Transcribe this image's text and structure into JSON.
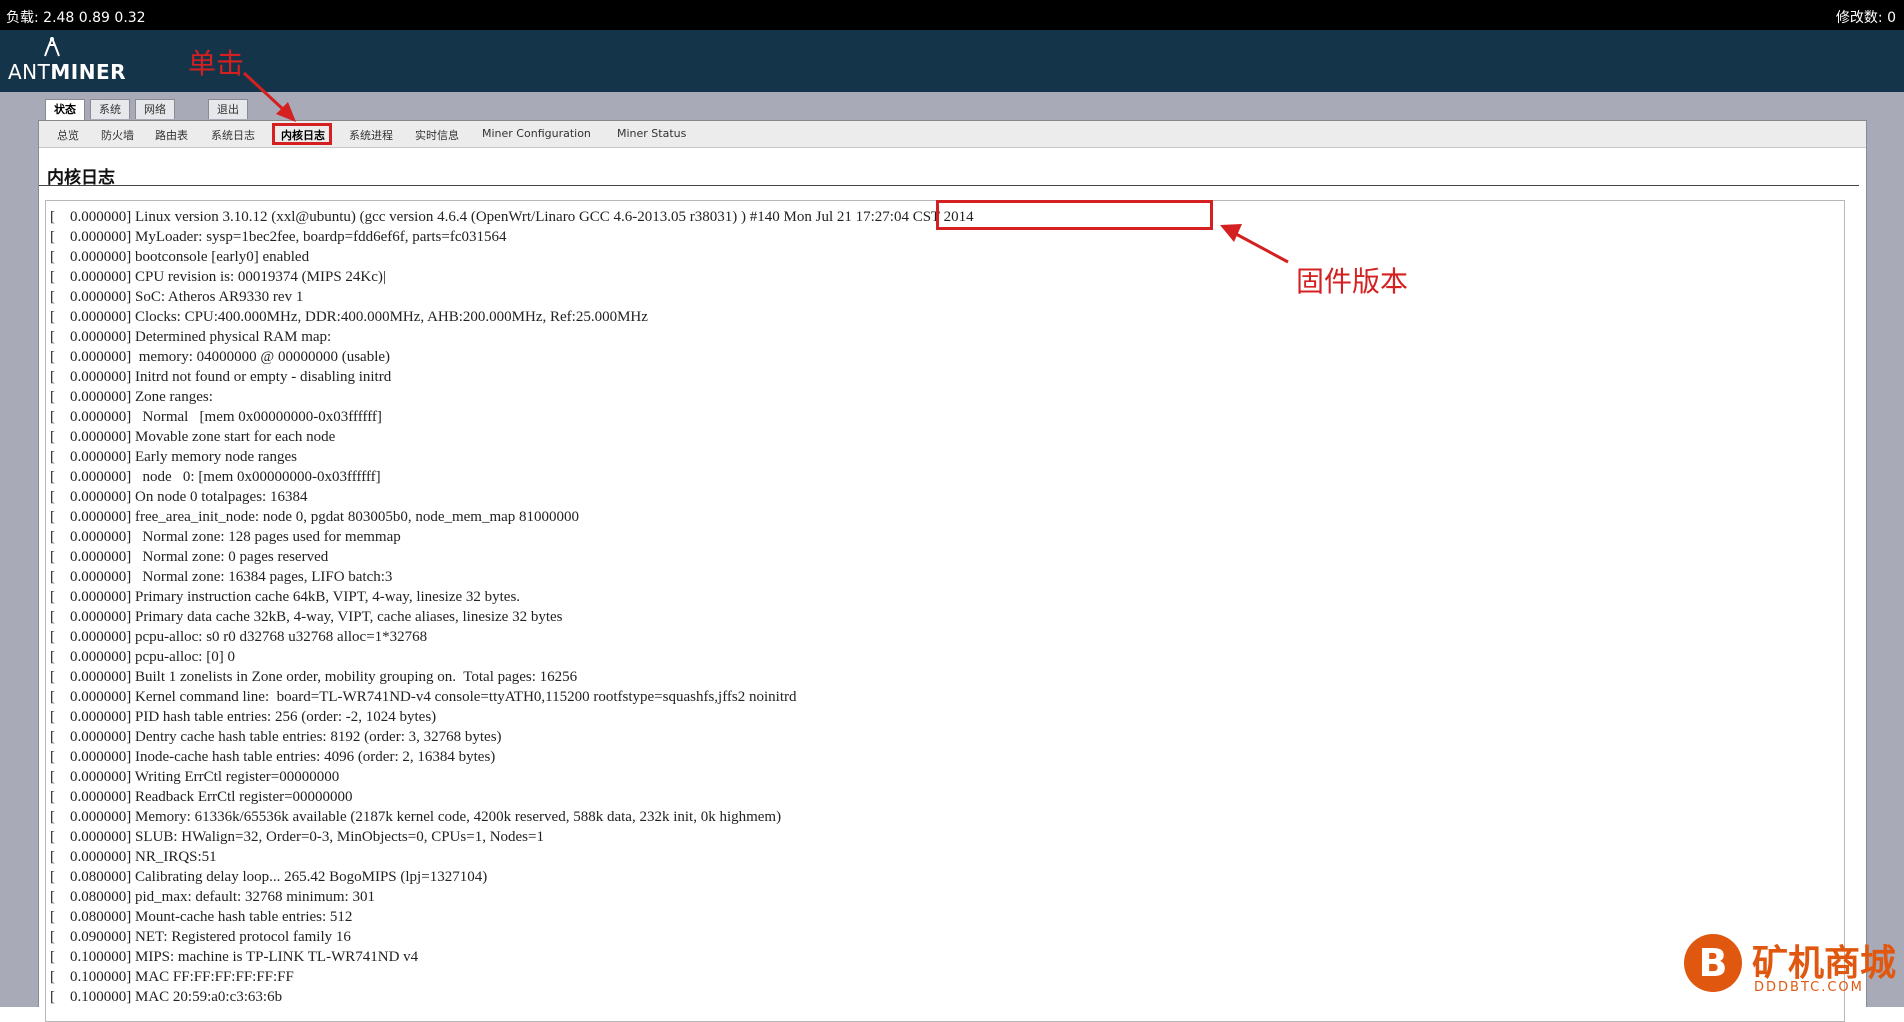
{
  "topbar": {
    "load": "负载: 2.48 0.89 0.32",
    "changes": "修改数: 0"
  },
  "logo": {
    "text_light": "ANT",
    "text_bold": "MINER"
  },
  "main_tabs": [
    {
      "label": "状态",
      "active": true
    },
    {
      "label": "系统",
      "active": false
    },
    {
      "label": "网络",
      "active": false
    },
    {
      "label": "退出",
      "active": false
    }
  ],
  "sub_tabs": [
    {
      "label": "总览",
      "active": false
    },
    {
      "label": "防火墙",
      "active": false
    },
    {
      "label": "路由表",
      "active": false
    },
    {
      "label": "系统日志",
      "active": false
    },
    {
      "label": "内核日志",
      "active": true
    },
    {
      "label": "系统进程",
      "active": false
    },
    {
      "label": "实时信息",
      "active": false
    },
    {
      "label": "Miner Configuration",
      "active": false
    },
    {
      "label": "Miner Status",
      "active": false
    }
  ],
  "page": {
    "title": "内核日志"
  },
  "annotations": {
    "click": "单击",
    "firmware": "固件版本",
    "color": "#d42020"
  },
  "log": [
    "[    0.000000] Linux version 3.10.12 (xxl@ubuntu) (gcc version 4.6.4 (OpenWrt/Linaro GCC 4.6-2013.05 r38031) ) #140 Mon Jul 21 17:27:04 CST 2014",
    "[    0.000000] MyLoader: sysp=1bec2fee, boardp=fdd6ef6f, parts=fc031564",
    "[    0.000000] bootconsole [early0] enabled",
    "[    0.000000] CPU revision is: 00019374 (MIPS 24Kc)|",
    "[    0.000000] SoC: Atheros AR9330 rev 1",
    "[    0.000000] Clocks: CPU:400.000MHz, DDR:400.000MHz, AHB:200.000MHz, Ref:25.000MHz",
    "[    0.000000] Determined physical RAM map:",
    "[    0.000000]  memory: 04000000 @ 00000000 (usable)",
    "[    0.000000] Initrd not found or empty - disabling initrd",
    "[    0.000000] Zone ranges:",
    "[    0.000000]   Normal   [mem 0x00000000-0x03ffffff]",
    "[    0.000000] Movable zone start for each node",
    "[    0.000000] Early memory node ranges",
    "[    0.000000]   node   0: [mem 0x00000000-0x03ffffff]",
    "[    0.000000] On node 0 totalpages: 16384",
    "[    0.000000] free_area_init_node: node 0, pgdat 803005b0, node_mem_map 81000000",
    "[    0.000000]   Normal zone: 128 pages used for memmap",
    "[    0.000000]   Normal zone: 0 pages reserved",
    "[    0.000000]   Normal zone: 16384 pages, LIFO batch:3",
    "[    0.000000] Primary instruction cache 64kB, VIPT, 4-way, linesize 32 bytes.",
    "[    0.000000] Primary data cache 32kB, 4-way, VIPT, cache aliases, linesize 32 bytes",
    "[    0.000000] pcpu-alloc: s0 r0 d32768 u32768 alloc=1*32768",
    "[    0.000000] pcpu-alloc: [0] 0",
    "[    0.000000] Built 1 zonelists in Zone order, mobility grouping on.  Total pages: 16256",
    "[    0.000000] Kernel command line:  board=TL-WR741ND-v4 console=ttyATH0,115200 rootfstype=squashfs,jffs2 noinitrd",
    "[    0.000000] PID hash table entries: 256 (order: -2, 1024 bytes)",
    "[    0.000000] Dentry cache hash table entries: 8192 (order: 3, 32768 bytes)",
    "[    0.000000] Inode-cache hash table entries: 4096 (order: 2, 16384 bytes)",
    "[    0.000000] Writing ErrCtl register=00000000",
    "[    0.000000] Readback ErrCtl register=00000000",
    "[    0.000000] Memory: 61336k/65536k available (2187k kernel code, 4200k reserved, 588k data, 232k init, 0k highmem)",
    "[    0.000000] SLUB: HWalign=32, Order=0-3, MinObjects=0, CPUs=1, Nodes=1",
    "[    0.000000] NR_IRQS:51",
    "[    0.080000] Calibrating delay loop... 265.42 BogoMIPS (lpj=1327104)",
    "[    0.080000] pid_max: default: 32768 minimum: 301",
    "[    0.080000] Mount-cache hash table entries: 512",
    "[    0.090000] NET: Registered protocol family 16",
    "[    0.100000] MIPS: machine is TP-LINK TL-WR741ND v4",
    "[    0.100000] MAC FF:FF:FF:FF:FF:FF",
    "[    0.100000] MAC 20:59:a0:c3:63:6b"
  ],
  "watermark": {
    "symbol": "B",
    "name": "矿机商城",
    "domain": "DDDBTC.COM",
    "color": "#e0580f"
  }
}
